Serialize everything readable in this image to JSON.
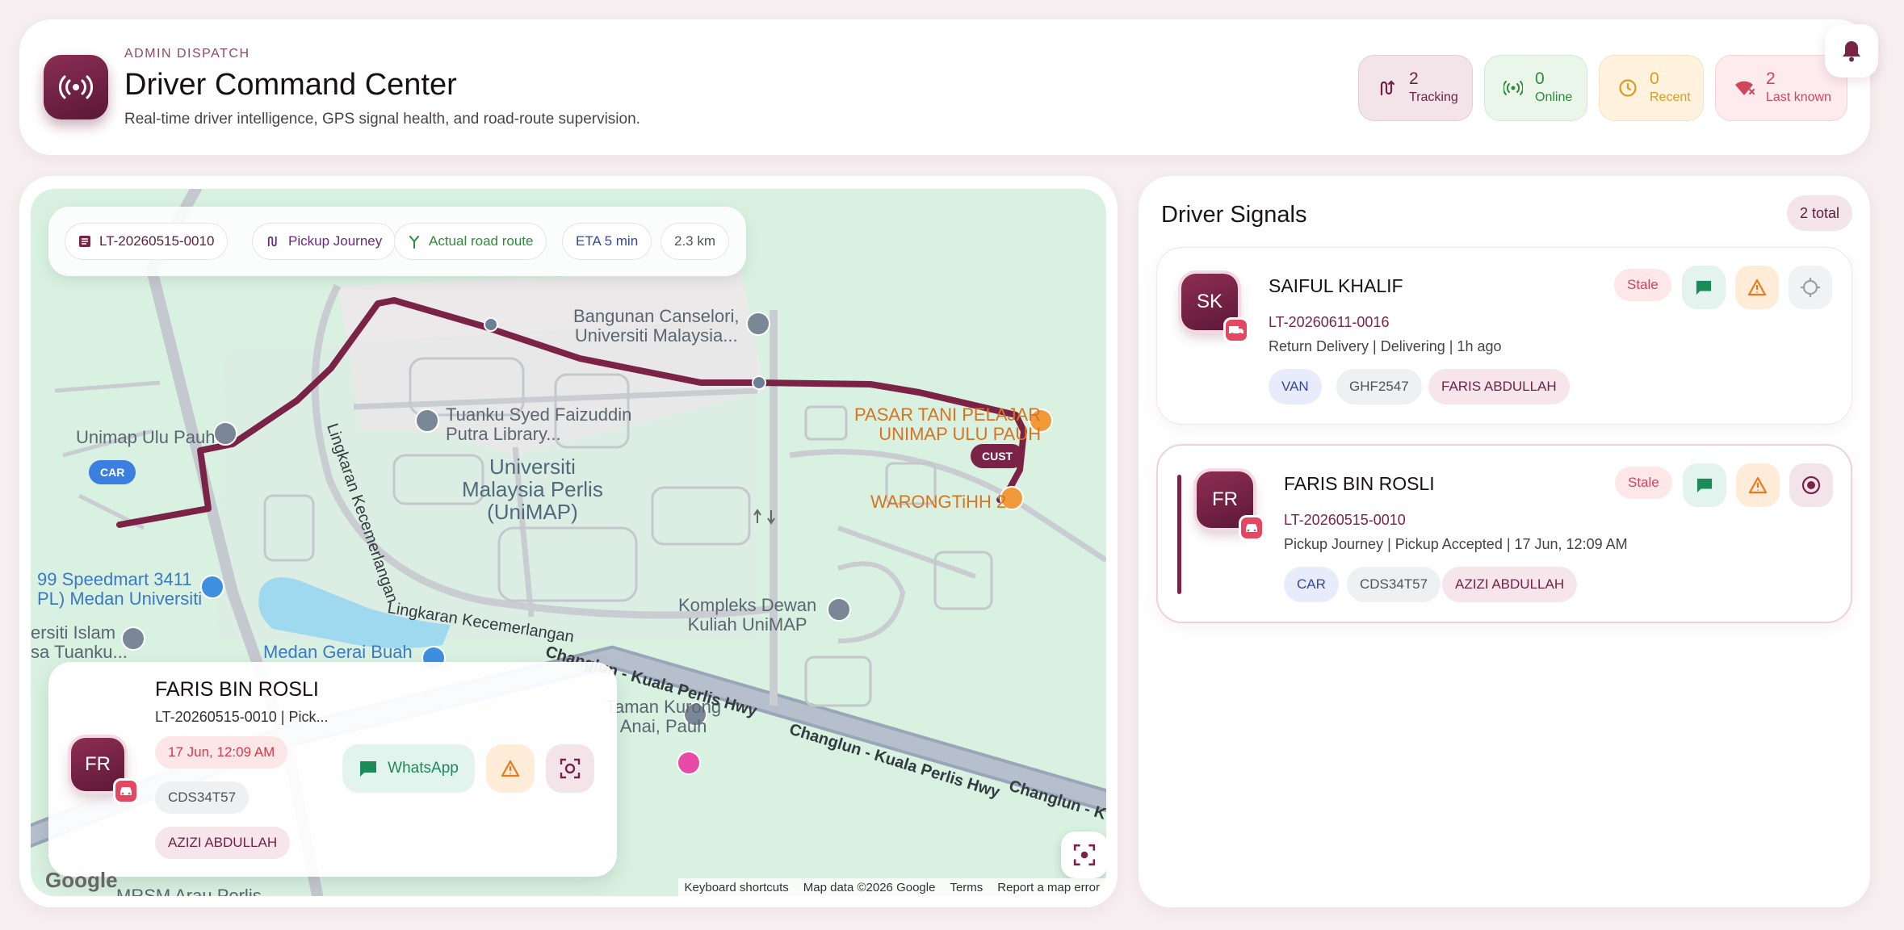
{
  "header": {
    "eyebrow": "ADMIN DISPATCH",
    "title": "Driver Command Center",
    "subtitle": "Real-time driver intelligence, GPS signal health, and road-route supervision.",
    "stats": {
      "tracking": {
        "value": "2",
        "label": "Tracking"
      },
      "online": {
        "value": "0",
        "label": "Online"
      },
      "recent": {
        "value": "0",
        "label": "Recent"
      },
      "last_known": {
        "value": "2",
        "label": "Last known"
      }
    }
  },
  "map": {
    "chips": {
      "booking": "LT-20260515-0010",
      "journey": "Pickup Journey",
      "route": "Actual road route",
      "eta": "ETA 5 min",
      "distance": "2.3 km"
    },
    "labels": {
      "canselori": "Bangunan Canselori,\nUniversiti Malaysia...",
      "library": "Tuanku Syed Faizuddin\nPutra Library...",
      "unimap": "Universiti\nMalaysia Perlis\n(UniMAP)",
      "ulu_pauh": "Unimap Ulu Pauh",
      "pasar": "PASAR TANI PELAJAR\nUNIMAP ULU PAUH",
      "warong": "WARONGTiHH 2",
      "speedmart": "99 Speedmart 3411\nPL) Medan Universiti",
      "islam": "ersiti Islam\nsa Tuanku...",
      "kompleks": "Kompleks Dewan\nKuliah UniMAP",
      "gerai": "Medan Gerai Buah",
      "kurong": "Taman Kurong\nAnai, Pauh",
      "arau": "MRSM Arau Perlis",
      "road_lingkaran_v": "Lingkaran Kecemerlangan",
      "road_lingkaran_h": "Lingkaran Kecemerlangan",
      "road_changlun_1": "Changlun - Kuala Perlis Hwy",
      "road_changlun_2": "Changlun - Kuala Perlis Hwy",
      "road_changlun_3": "Changlun - K"
    },
    "pins": {
      "car": "CAR",
      "cust": "CUST"
    },
    "footer": {
      "google": "Google",
      "shortcuts": "Keyboard shortcuts",
      "data": "Map data ©2026 Google",
      "terms": "Terms",
      "report": "Report a map error"
    },
    "overlay": {
      "initials": "FR",
      "name": "FARIS BIN ROSLI",
      "ref": "LT-20260515-0010 | Pick...",
      "time": "17 Jun, 12:09 AM",
      "plate": "CDS34T57",
      "assignee": "AZIZI ABDULLAH",
      "whatsapp": "WhatsApp"
    }
  },
  "signals": {
    "title": "Driver Signals",
    "total": "2 total",
    "drivers": [
      {
        "initials": "SK",
        "name": "SAIFUL KHALIF",
        "ref": "LT-20260611-0016",
        "meta": "Return Delivery | Delivering | 1h ago",
        "status": "Stale",
        "vehicle": "VAN",
        "plate": "GHF2547",
        "assignee": "FARIS ABDULLAH"
      },
      {
        "initials": "FR",
        "name": "FARIS BIN ROSLI",
        "ref": "LT-20260515-0010",
        "meta": "Pickup Journey | Pickup Accepted | 17 Jun, 12:09 AM",
        "status": "Stale",
        "vehicle": "CAR",
        "plate": "CDS34T57",
        "assignee": "AZIZI ABDULLAH"
      }
    ]
  },
  "colors": {
    "brand": "#7b2346",
    "online": "#2e8a3a",
    "recent": "#e09a1b",
    "last_known": "#d1465a",
    "route": "#7b2346",
    "map_bg": "#d8f1e1"
  },
  "icons": {
    "brand": "broadcast-icon",
    "tracking": "route-icon",
    "online": "signal-icon",
    "recent": "clock-icon",
    "last_known": "wifi-off-icon",
    "notifications": "bell-icon"
  }
}
